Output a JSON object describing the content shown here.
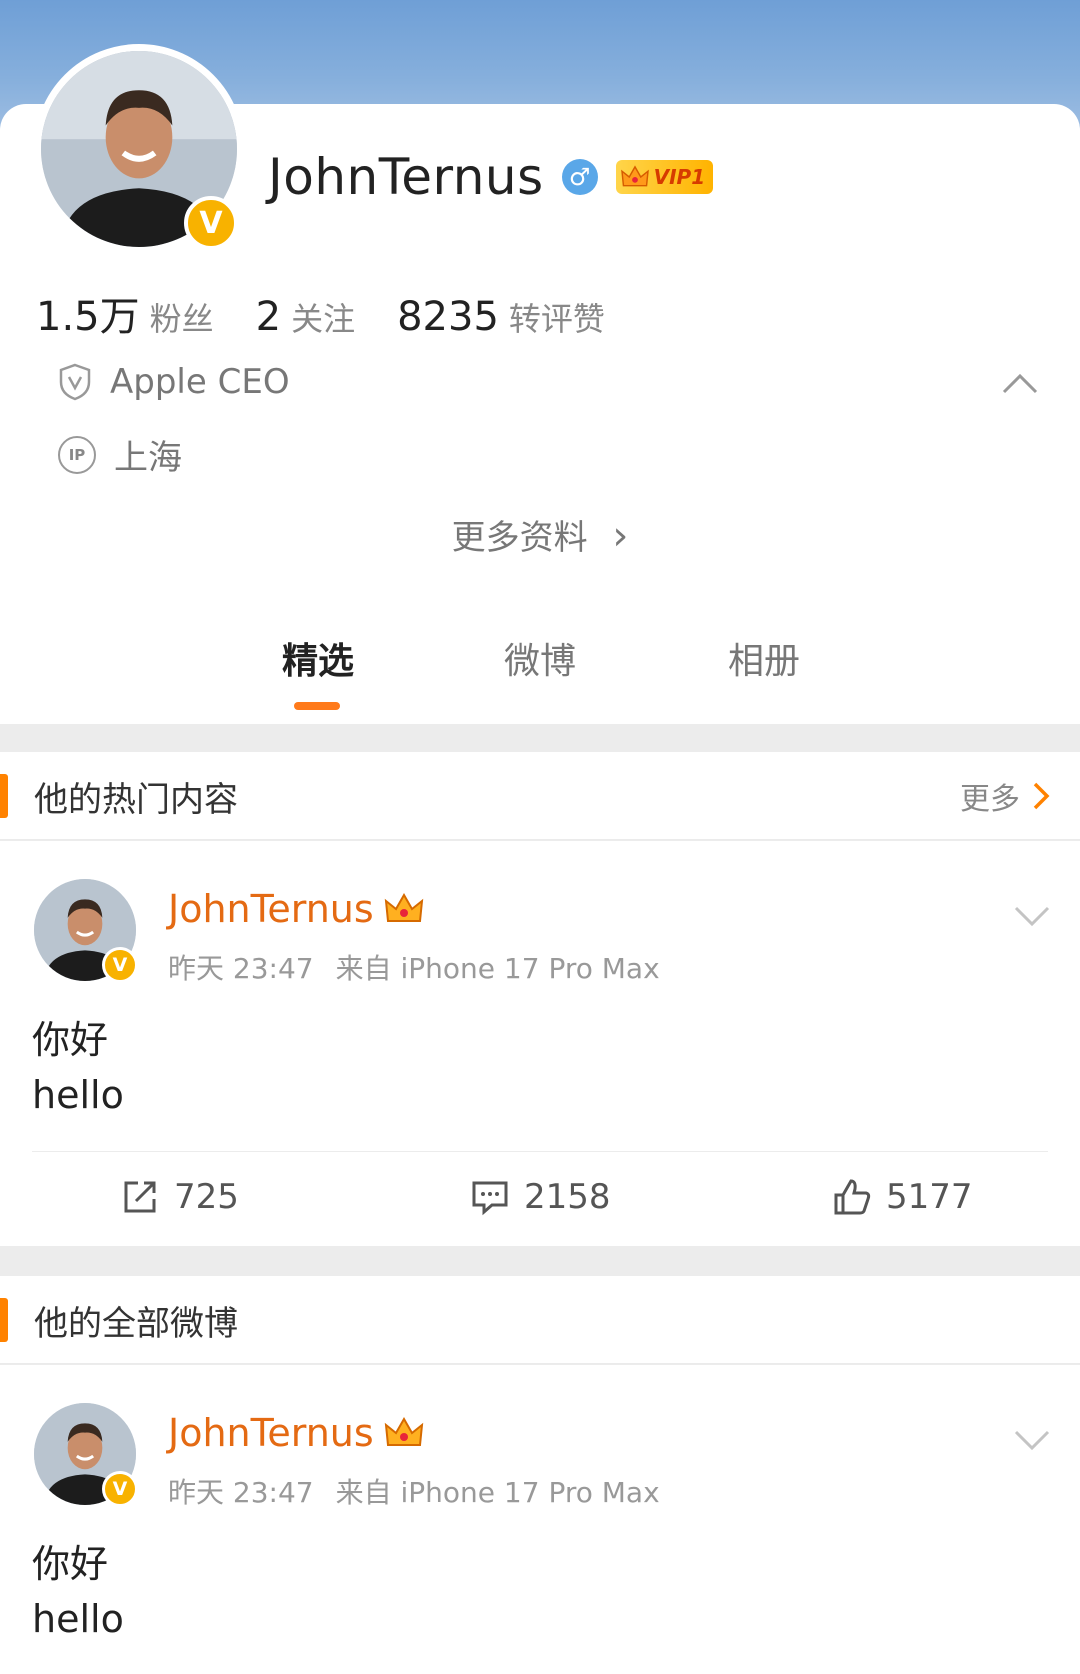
{
  "profile": {
    "name": "JohnTernus",
    "gender_symbol": "♂",
    "vip_label": "VIP1",
    "verified_mark": "V",
    "stats": [
      {
        "value": "1.5万",
        "label": "粉丝"
      },
      {
        "value": "2",
        "label": "关注"
      },
      {
        "value": "8235",
        "label": "转评赞"
      }
    ],
    "title": "Apple CEO",
    "ip_icon_text": "IP",
    "location": "上海",
    "more_info": "更多资料",
    "more_info_arrow": "›"
  },
  "tabs": [
    {
      "label": "精选",
      "active": true
    },
    {
      "label": "微博",
      "active": false
    },
    {
      "label": "相册",
      "active": false
    }
  ],
  "hot_section": {
    "title": "他的热门内容",
    "more": "更多"
  },
  "all_section": {
    "title": "他的全部微博"
  },
  "posts": [
    {
      "author": "JohnTernus",
      "time": "昨天 23:47",
      "source": "来自 iPhone 17 Pro Max",
      "lines": [
        "你好",
        "hello"
      ],
      "reposts": "725",
      "comments": "2158",
      "likes": "5177"
    },
    {
      "author": "JohnTernus",
      "time": "昨天 23:47",
      "source": "来自 iPhone 17 Pro Max",
      "lines": [
        "你好",
        "hello"
      ]
    }
  ],
  "colors": {
    "accent": "#ff8200",
    "author_name": "#e46a13",
    "verified_badge": "#f8b200",
    "gender_badge": "#5aa7e8",
    "banner": "#7aa6d9"
  }
}
